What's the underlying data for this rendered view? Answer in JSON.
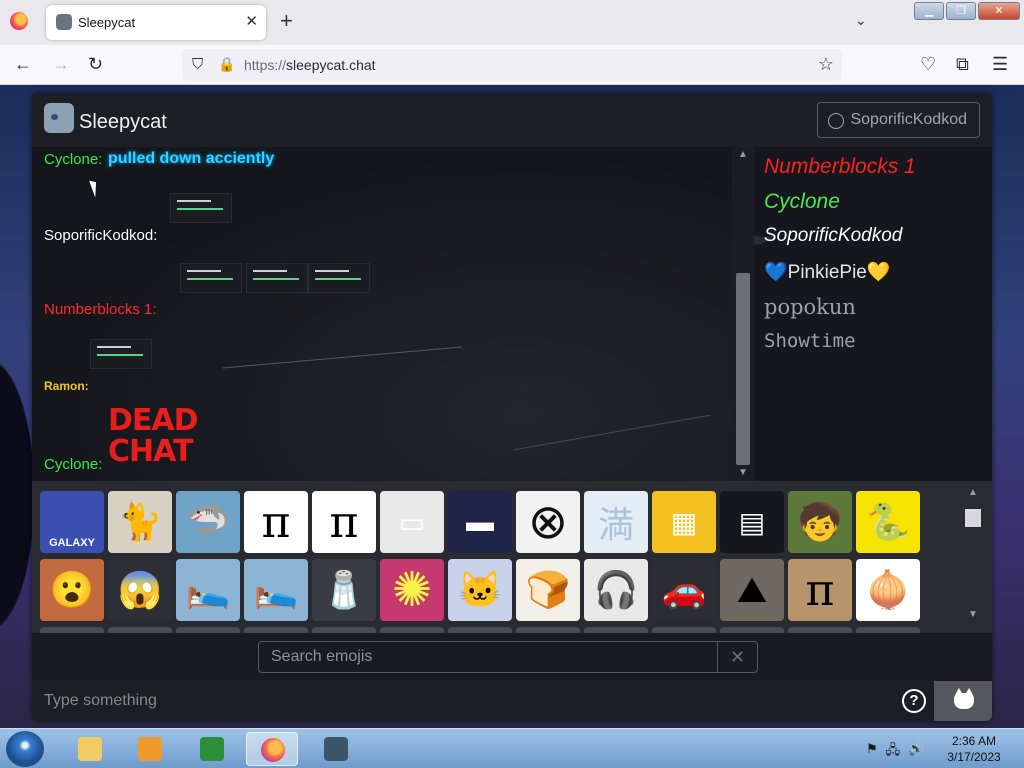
{
  "browser": {
    "tab_title": "Sleepycat",
    "tab_close": "✕",
    "new_tab": "+",
    "tab_list": "⌄",
    "window_buttons": {
      "minimize": "▁",
      "maximize": "❐",
      "close": "✕"
    },
    "url_protocol": "https://",
    "url_host": "sleepycat.chat",
    "nav": {
      "back": "←",
      "forward": "→",
      "reload": "↻",
      "pocket": "♡",
      "extensions": "⧉",
      "menu": "☰",
      "bookmark": "☆",
      "shield": "⛉",
      "lock": "🔒"
    }
  },
  "app": {
    "title": "Sleepycat",
    "user_button": "SoporificKodkod"
  },
  "messages": [
    {
      "name": "Cyclone:",
      "text": "pulled down acciently",
      "name_color": "#39e84a"
    },
    {
      "name": "SoporificKodkod:",
      "name_color": "#ffffff"
    },
    {
      "name": "Numberblocks 1:",
      "name_color": "#ff2a2a"
    },
    {
      "name": "Ramon:",
      "name_color": "#f0c430"
    },
    {
      "name": "Cyclone:",
      "name_color": "#39e84a"
    }
  ],
  "dead_chat": {
    "line1": "DEAD",
    "line2": "CHAT"
  },
  "users": [
    {
      "name": "Numberblocks 1",
      "color": "#ff2020"
    },
    {
      "name": "Cyclone",
      "color": "#4be85a"
    },
    {
      "name": "SoporificKodkod",
      "color": "#ffffff"
    },
    {
      "name": "💙PinkiePie💛",
      "color": "#e6e6e6"
    },
    {
      "name": "popokun",
      "color": "#9ea0a6"
    },
    {
      "name": "Showtime",
      "color": "#9ea0a6"
    }
  ],
  "emojis_row1": [
    {
      "name": "galaxy-emoji",
      "glyph": "GALAXY",
      "bg": "#3a4fb0"
    },
    {
      "name": "cat-emoji",
      "glyph": "🐈",
      "bg": "#d8d2c4"
    },
    {
      "name": "shark-girl-emoji",
      "glyph": "🦈",
      "bg": "#6fa3c8"
    },
    {
      "name": "pi-emoji",
      "glyph": "π",
      "bg": "#ffffff"
    },
    {
      "name": "pi-emoji-2",
      "glyph": "π",
      "bg": "#ffffff"
    },
    {
      "name": "screenshot-emoji",
      "glyph": "▭",
      "bg": "#e8e8e8"
    },
    {
      "name": "smoking-meme-emoji",
      "glyph": "▬",
      "bg": "#1d2448"
    },
    {
      "name": "x-circle-emoji",
      "glyph": "⊗",
      "bg": "#f2f2f2"
    },
    {
      "name": "kanji-emoji",
      "glyph": "満",
      "bg": "#e4eef6"
    },
    {
      "name": "cheez-its-emoji",
      "glyph": "▦",
      "bg": "#f4c01f"
    },
    {
      "name": "chat-screenshot-emoji",
      "glyph": "▤",
      "bg": "#16171c"
    },
    {
      "name": "kid-emoji",
      "glyph": "🧒",
      "bg": "#5e7a3a"
    },
    {
      "name": "no-step-snek-emoji",
      "glyph": "🐍",
      "bg": "#f4e400"
    }
  ],
  "emojis_row2": [
    {
      "name": "face-emoji",
      "glyph": "😮",
      "bg": "#c26a40"
    },
    {
      "name": "screaming-emoji",
      "glyph": "😱",
      "bg": "#2d2f36"
    },
    {
      "name": "blanket-emoji",
      "glyph": "🛌",
      "bg": "#8db4d4"
    },
    {
      "name": "blanket-emoji-2",
      "glyph": "🛌",
      "bg": "#8db4d4"
    },
    {
      "name": "salt-emoji",
      "glyph": "🧂",
      "bg": "#3a3c44"
    },
    {
      "name": "rays-emoji",
      "glyph": "✺",
      "bg": "#c6396f"
    },
    {
      "name": "nyan-cat-emoji",
      "glyph": "🐱",
      "bg": "#c8d2ea"
    },
    {
      "name": "toast-emoji",
      "glyph": "🍞",
      "bg": "#f2efe8"
    },
    {
      "name": "headphones-emoji",
      "glyph": "🎧",
      "bg": "#e8e8e8"
    },
    {
      "name": "car-emoji",
      "glyph": "🚗",
      "bg": "#2b2d33"
    },
    {
      "name": "rubble-emoji",
      "glyph": "⛰",
      "bg": "#6e6a62"
    },
    {
      "name": "pi-cookie-emoji",
      "glyph": "π",
      "bg": "#b7946a"
    },
    {
      "name": "onion-emoji",
      "glyph": "🧅",
      "bg": "#ffffff"
    }
  ],
  "search": {
    "placeholder": "Search emojis",
    "clear": "✕"
  },
  "compose": {
    "placeholder": "Type something",
    "help": "?"
  },
  "taskbar": {
    "time": "2:36 AM",
    "date": "3/17/2023",
    "tray_flag": "⚑",
    "tray_network": "🖧",
    "tray_volume": "🔊"
  }
}
